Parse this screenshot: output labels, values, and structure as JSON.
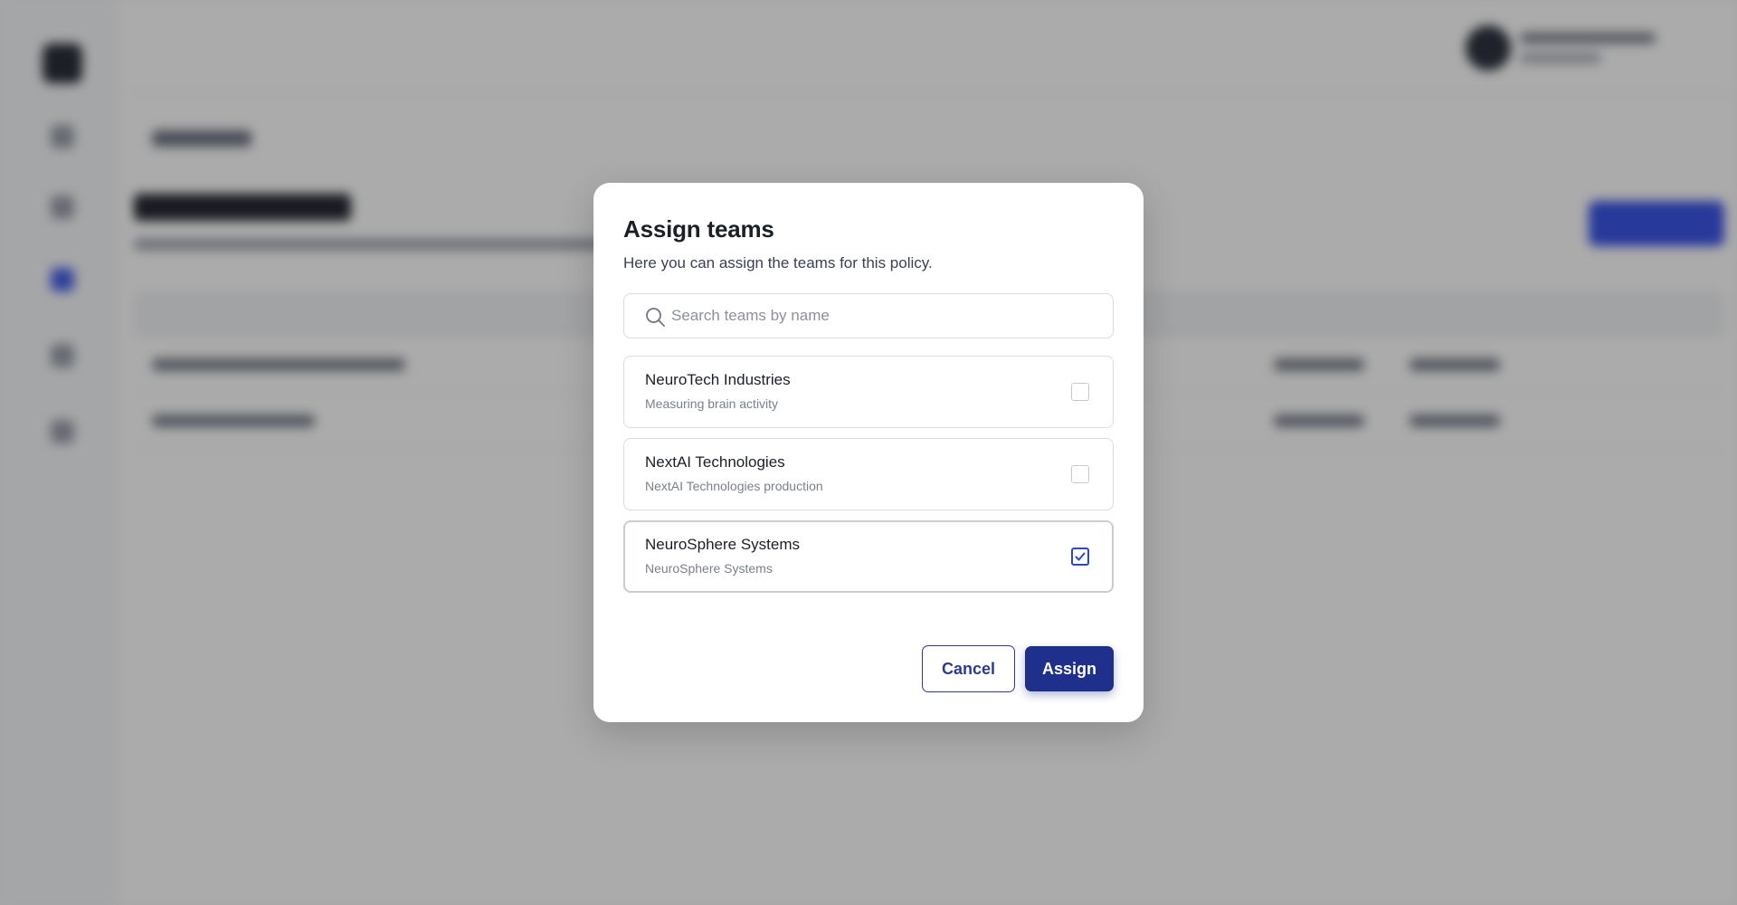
{
  "modal": {
    "title": "Assign teams",
    "description": "Here you can assign the teams for this policy.",
    "search": {
      "placeholder": "Search teams by name",
      "value": ""
    },
    "teams": [
      {
        "name": "NeuroTech Industries",
        "description": "Measuring brain activity",
        "checked": false
      },
      {
        "name": "NextAI Technologies",
        "description": "NextAI Technologies production",
        "checked": false
      },
      {
        "name": "NeuroSphere Systems",
        "description": "NeuroSphere Systems",
        "checked": true
      }
    ],
    "cancel_label": "Cancel",
    "assign_label": "Assign"
  },
  "colors": {
    "primary": "#1f2f8c",
    "checkbox_checked": "#2d47c8",
    "overlay": "rgba(0,0,0,0.33)"
  },
  "icons": {
    "search": "search-icon",
    "checkbox_checked": "checkmark-icon"
  }
}
